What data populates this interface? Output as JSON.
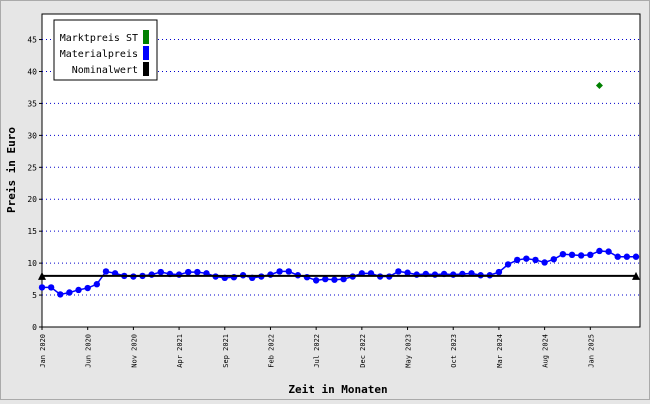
{
  "chart_data": {
    "type": "line",
    "xlabel": "Zeit in Monaten",
    "ylabel": "Preis in Euro",
    "ylim": [
      0,
      49
    ],
    "yticks": [
      0,
      5,
      10,
      15,
      20,
      25,
      30,
      35,
      40,
      45
    ],
    "grid": "horizontal dotted",
    "legend_position": "top-left",
    "x_start": "2020-01",
    "x_end": "2025-06",
    "x_tick_labels": [
      {
        "label": "Jan 2020",
        "month": "2020-01"
      },
      {
        "label": "Jun 2020",
        "month": "2020-06"
      },
      {
        "label": "Nov 2020",
        "month": "2020-11"
      },
      {
        "label": "Apr 2021",
        "month": "2021-04"
      },
      {
        "label": "Sep 2021",
        "month": "2021-09"
      },
      {
        "label": "Feb 2022",
        "month": "2022-02"
      },
      {
        "label": "Jul 2022",
        "month": "2022-07"
      },
      {
        "label": "Dec 2022",
        "month": "2022-12"
      },
      {
        "label": "May 2023",
        "month": "2023-05"
      },
      {
        "label": "Oct 2023",
        "month": "2023-10"
      },
      {
        "label": "Mar 2024",
        "month": "2024-03"
      },
      {
        "label": "Aug 2024",
        "month": "2024-08"
      },
      {
        "label": "Jan 2025",
        "month": "2025-01"
      }
    ],
    "legend": [
      {
        "label": "Marktpreis ST",
        "color": "#008000"
      },
      {
        "label": "Materialpreis",
        "color": "#0000ff"
      },
      {
        "label": "Nominalwert",
        "color": "#000000"
      }
    ],
    "series": [
      {
        "name": "Materialpreis",
        "color": "#0000ff",
        "style": "line+markers",
        "months": [
          "2020-01",
          "2020-02",
          "2020-03",
          "2020-04",
          "2020-05",
          "2020-06",
          "2020-07",
          "2020-08",
          "2020-09",
          "2020-10",
          "2020-11",
          "2020-12",
          "2021-01",
          "2021-02",
          "2021-03",
          "2021-04",
          "2021-05",
          "2021-06",
          "2021-07",
          "2021-08",
          "2021-09",
          "2021-10",
          "2021-11",
          "2021-12",
          "2022-01",
          "2022-02",
          "2022-03",
          "2022-04",
          "2022-05",
          "2022-06",
          "2022-07",
          "2022-08",
          "2022-09",
          "2022-10",
          "2022-11",
          "2022-12",
          "2023-01",
          "2023-02",
          "2023-03",
          "2023-04",
          "2023-05",
          "2023-06",
          "2023-07",
          "2023-08",
          "2023-09",
          "2023-10",
          "2023-11",
          "2023-12",
          "2024-01",
          "2024-02",
          "2024-03",
          "2024-04",
          "2024-05",
          "2024-06",
          "2024-07",
          "2024-08",
          "2024-09",
          "2024-10",
          "2024-11",
          "2024-12",
          "2025-01",
          "2025-02",
          "2025-03",
          "2025-04",
          "2025-05",
          "2025-06"
        ],
        "values": [
          6.2,
          6.2,
          5.1,
          5.4,
          5.8,
          6.1,
          6.7,
          8.7,
          8.4,
          8.0,
          7.9,
          8.0,
          8.2,
          8.6,
          8.3,
          8.2,
          8.6,
          8.6,
          8.4,
          7.9,
          7.7,
          7.8,
          8.1,
          7.7,
          7.9,
          8.2,
          8.7,
          8.7,
          8.1,
          7.8,
          7.3,
          7.5,
          7.4,
          7.5,
          7.9,
          8.4,
          8.4,
          7.9,
          7.9,
          8.7,
          8.5,
          8.2,
          8.3,
          8.2,
          8.3,
          8.2,
          8.3,
          8.4,
          8.1,
          8.1,
          8.6,
          9.8,
          10.5,
          10.7,
          10.5,
          10.1,
          10.6,
          11.4,
          11.3,
          11.2,
          11.3,
          11.9,
          11.8,
          11.0,
          11.0,
          11.0
        ]
      },
      {
        "name": "Nominalwert",
        "color": "#000000",
        "style": "line+end-markers",
        "months": [
          "2020-01",
          "2025-06"
        ],
        "values": [
          8.0,
          8.0
        ]
      },
      {
        "name": "Marktpreis ST",
        "color": "#008000",
        "style": "marker",
        "months": [
          "2025-02"
        ],
        "values": [
          37.8
        ]
      }
    ]
  }
}
